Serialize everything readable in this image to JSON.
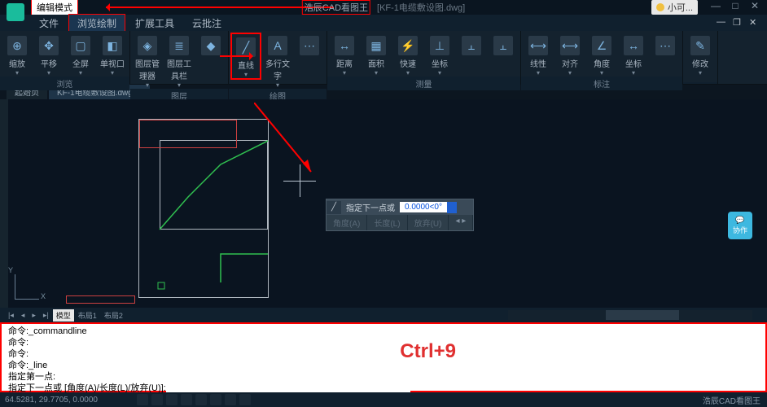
{
  "title": {
    "mode": "编辑模式",
    "app": "浩辰CAD看图王",
    "file": "[KF-1电缆敷设图.dwg]",
    "user": "小可..."
  },
  "menubar": [
    "文件",
    "浏览绘制",
    "扩展工具",
    "云批注"
  ],
  "ribbon": {
    "groups": [
      {
        "label": "浏览",
        "items": [
          {
            "icon": "⊕",
            "name": "zoom",
            "label": "缩放"
          },
          {
            "icon": "✥",
            "name": "pan",
            "label": "平移"
          },
          {
            "icon": "▢",
            "name": "fullscreen",
            "label": "全屏"
          },
          {
            "icon": "◧",
            "name": "viewport",
            "label": "单视口"
          }
        ]
      },
      {
        "label": "图层",
        "items": [
          {
            "icon": "◈",
            "name": "layer-mgr",
            "label": "图层管理器"
          },
          {
            "icon": "≣",
            "name": "layer-tools",
            "label": "图层工具栏"
          },
          {
            "icon": "◆",
            "name": "layer-extra",
            "label": ""
          }
        ]
      },
      {
        "label": "绘图",
        "items": [
          {
            "icon": "╱",
            "name": "line",
            "label": "直线",
            "hl": true
          },
          {
            "icon": "A",
            "name": "mtext",
            "label": "多行文字"
          },
          {
            "icon": "⋯",
            "name": "draw-more",
            "label": ""
          }
        ]
      },
      {
        "label": "测量",
        "items": [
          {
            "icon": "↔",
            "name": "distance",
            "label": "距离"
          },
          {
            "icon": "▦",
            "name": "area",
            "label": "面积"
          },
          {
            "icon": "⚡",
            "name": "quick",
            "label": "快速"
          },
          {
            "icon": "⊥",
            "name": "coord",
            "label": "坐标"
          },
          {
            "icon": "⫠",
            "name": "measure-a",
            "label": ""
          },
          {
            "icon": "⫠",
            "name": "measure-b",
            "label": ""
          }
        ]
      },
      {
        "label": "标注",
        "items": [
          {
            "icon": "⟷",
            "name": "linear",
            "label": "线性"
          },
          {
            "icon": "⟷",
            "name": "aligned",
            "label": "对齐"
          },
          {
            "icon": "∠",
            "name": "angle",
            "label": "角度"
          },
          {
            "icon": "↔",
            "name": "dim-coord",
            "label": "坐标"
          },
          {
            "icon": "⋯",
            "name": "dim-more",
            "label": ""
          }
        ]
      },
      {
        "label": "",
        "items": [
          {
            "icon": "✎",
            "name": "modify",
            "label": "修改"
          }
        ]
      }
    ]
  },
  "tabs": {
    "start": "起始页",
    "file": "KF-1电缆敷设图.dwg"
  },
  "prompt": {
    "text": "指定下一点或",
    "value": "0.0000<0°",
    "opts": [
      "角度(A)",
      "长度(L)",
      "放弃(U)"
    ]
  },
  "chat": "协作",
  "layout": {
    "nav": [
      "|◂",
      "◂",
      "▸",
      "▸|"
    ],
    "tabs": [
      "模型",
      "布局1",
      "布局2"
    ]
  },
  "command": {
    "lines": [
      "命令:_commandline",
      "命令:",
      "命令:",
      "命令:_line",
      "指定第一点:"
    ],
    "current": "指定下一点或 [角度(A)/长度(L)/放弃(U)]:",
    "overlay": "Ctrl+9"
  },
  "status": {
    "coords": "64.5281, 29.7705, 0.0000",
    "brand": "浩辰CAD看图王"
  }
}
